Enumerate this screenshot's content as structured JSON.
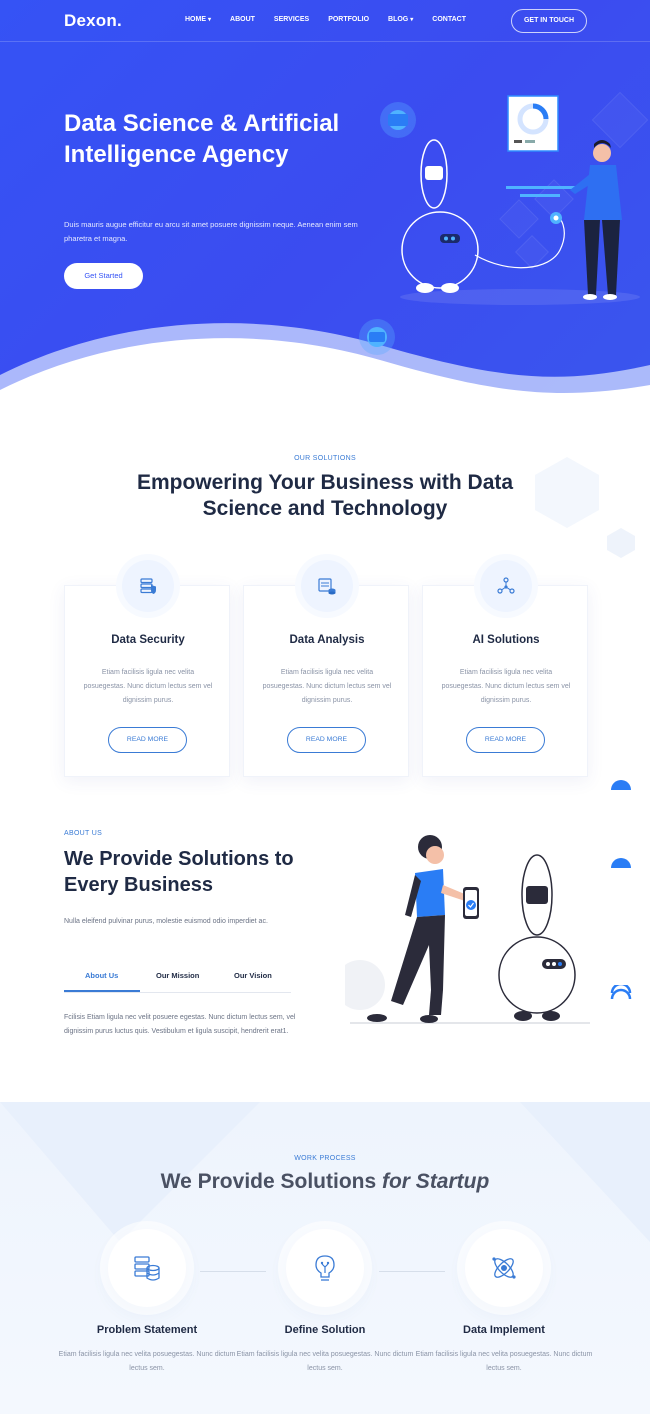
{
  "nav": {
    "logo": "Dexon.",
    "items": [
      {
        "label": "HOME",
        "has_caret": true
      },
      {
        "label": "ABOUT",
        "has_caret": false
      },
      {
        "label": "SERVICES",
        "has_caret": false
      },
      {
        "label": "PORTFOLIO",
        "has_caret": false
      },
      {
        "label": "BLOG",
        "has_caret": true
      },
      {
        "label": "CONTACT",
        "has_caret": false
      }
    ],
    "cta": "GET IN TOUCH"
  },
  "hero": {
    "title": "Data Science & Artificial Intelligence Agency",
    "text": "Duis mauris augue efficitur eu arcu sit amet posuere dignissim neque. Aenean enim sem pharetra et magna.",
    "button": "Get Started",
    "background_color": "#3553f5"
  },
  "solutions": {
    "eyebrow": "OUR SOLUTIONS",
    "title": "Empowering Your Business with Data Science and Technology",
    "cards": [
      {
        "icon": "database-shield-icon",
        "title": "Data Security",
        "text": "Etiam facilisis ligula nec velita posuegestas. Nunc dictum lectus sem vel dignissim purus.",
        "button": "READ MORE"
      },
      {
        "icon": "data-analysis-icon",
        "title": "Data Analysis",
        "text": "Etiam facilisis ligula nec velita posuegestas. Nunc dictum lectus sem vel dignissim purus.",
        "button": "READ MORE"
      },
      {
        "icon": "ai-network-icon",
        "title": "AI Solutions",
        "text": "Etiam facilisis ligula nec velita posuegestas. Nunc dictum lectus sem vel dignissim purus.",
        "button": "READ MORE"
      }
    ]
  },
  "about": {
    "eyebrow": "ABOUT US",
    "title": "We Provide Solutions to Every Business",
    "text": "Nulla eleifend pulvinar purus, molestie euismod odio imperdiet ac.",
    "tabs": [
      "About Us",
      "Our Mission",
      "Our Vision"
    ],
    "active_tab": "About Us",
    "tab_text": "Fcilisis Etiam ligula nec velit posuere egestas. Nunc dictum lectus sem, vel dignissim purus luctus quis. Vestibulum et ligula suscipit, hendrerit erat1."
  },
  "process": {
    "eyebrow": "WORK PROCESS",
    "title_main": "We Provide Solutions ",
    "title_em": "for Startup",
    "steps": [
      {
        "icon": "server-database-icon",
        "title": "Problem Statement",
        "text": "Etiam facilisis ligula nec velita posuegestas. Nunc dictum lectus sem."
      },
      {
        "icon": "lightbulb-circuit-icon",
        "title": "Define Solution",
        "text": "Etiam facilisis ligula nec velita posuegestas. Nunc dictum lectus sem."
      },
      {
        "icon": "atom-network-icon",
        "title": "Data Implement",
        "text": "Etiam facilisis ligula nec velita posuegestas. Nunc dictum lectus sem."
      }
    ]
  },
  "colors": {
    "primary": "#3553f5",
    "accent": "#3a7bd5",
    "heading": "#1f2a44",
    "muted": "#8a93a6"
  }
}
